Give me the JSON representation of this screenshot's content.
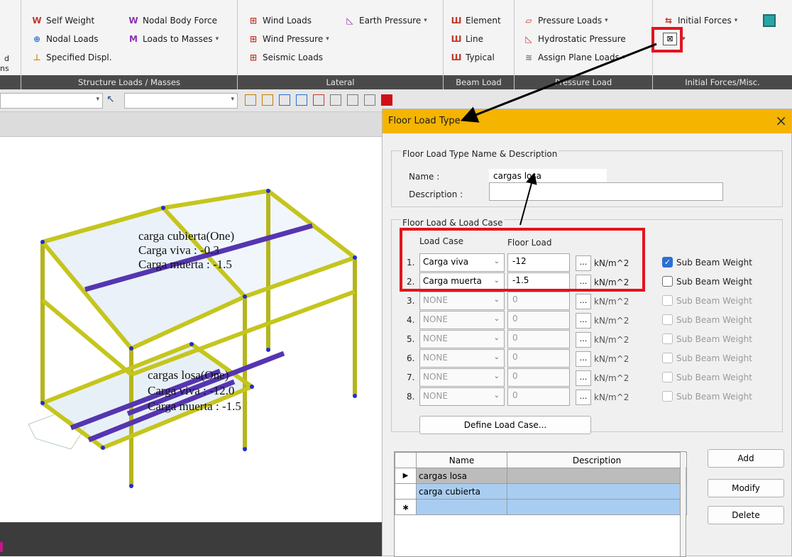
{
  "ribbon": {
    "structure_loads": {
      "self_weight": "Self Weight",
      "nodal_body_force": "Nodal Body Force",
      "nodal_loads": "Nodal Loads",
      "loads_to_masses": "Loads to Masses",
      "specified_displ": "Specified Displ.",
      "footer": "Structure Loads / Masses"
    },
    "left_partial": [
      "d",
      "ns"
    ],
    "lateral": {
      "wind_loads": "Wind Loads",
      "earth_pressure": "Earth Pressure",
      "wind_pressure": "Wind Pressure",
      "seismic_loads": "Seismic Loads",
      "footer": "Lateral"
    },
    "beam_load": {
      "element": "Element",
      "line": "Line",
      "typical": "Typical",
      "footer": "Beam Load"
    },
    "pressure_load": {
      "pressure_loads": "Pressure Loads",
      "hydrostatic_pressure": "Hydrostatic Pressure",
      "assign_plane_loads": "Assign Plane Loads",
      "footer": "Pressure Load"
    },
    "initial_forces": {
      "initial_forces": "Initial Forces",
      "footer": "Initial Forces/Misc."
    }
  },
  "canvas": {
    "roof_label": [
      "carga cubierta(One)",
      "Carga viva : -0.3",
      "Carga muerta : -1.5"
    ],
    "floor_label": [
      "cargas losa(One)",
      "Carga viva : -12.0",
      "Carga muerta : -1.5"
    ]
  },
  "dialog": {
    "title": "Floor Load Type",
    "close": "×",
    "section_name": "Floor Load Type Name & Description",
    "name_label": "Name :",
    "name_value": "cargas losa",
    "description_label": "Description :",
    "description_value": "",
    "section_loads": "Floor Load & Load Case",
    "col_load_case": "Load Case",
    "col_floor_load": "Floor Load",
    "unit": "kN/m^2",
    "ellipsis": "...",
    "sub_beam_weight": "Sub Beam Weight",
    "rows": [
      {
        "num": "1.",
        "case": "Carga viva",
        "load": "-12",
        "checked": true
      },
      {
        "num": "2.",
        "case": "Carga muerta",
        "load": "-1.5",
        "checked": false
      },
      {
        "num": "3.",
        "case": "NONE",
        "load": "0",
        "checked": false
      },
      {
        "num": "4.",
        "case": "NONE",
        "load": "0",
        "checked": false
      },
      {
        "num": "5.",
        "case": "NONE",
        "load": "0",
        "checked": false
      },
      {
        "num": "6.",
        "case": "NONE",
        "load": "0",
        "checked": false
      },
      {
        "num": "7.",
        "case": "NONE",
        "load": "0",
        "checked": false
      },
      {
        "num": "8.",
        "case": "NONE",
        "load": "0",
        "checked": false
      }
    ],
    "define_load_case": "Define Load Case...",
    "table": {
      "headers": [
        "Name",
        "Description"
      ],
      "rows": [
        {
          "marker": "▶",
          "name": "cargas losa",
          "description": ""
        },
        {
          "marker": "",
          "name": "carga cubierta",
          "description": ""
        },
        {
          "marker": "∗",
          "name": "",
          "description": ""
        }
      ]
    },
    "add": "Add",
    "modify": "Modify",
    "delete": "Delete"
  }
}
